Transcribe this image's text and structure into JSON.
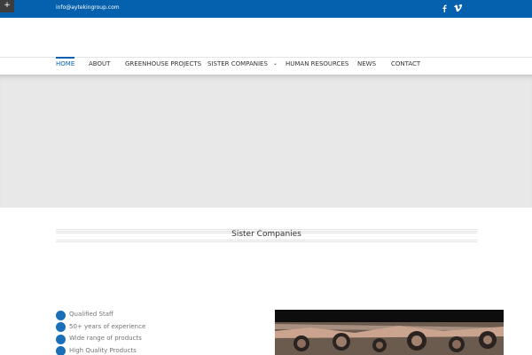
{
  "topbar": {
    "email": "info@aytekingroup.com",
    "corner_symbol": "+",
    "social": [
      {
        "icon": "facebook-icon"
      },
      {
        "icon": "vimeo-icon"
      }
    ],
    "background_color": "#0561ad"
  },
  "nav": {
    "items": [
      {
        "label": "HOME",
        "active": true
      },
      {
        "label": "ABOUT"
      },
      {
        "label": "GREENHOUSE PROJECTS"
      },
      {
        "label": "SISTER COMPANIES",
        "has_dropdown": true
      },
      {
        "label": "HUMAN RESOURCES"
      },
      {
        "label": "NEWS"
      },
      {
        "label": "CONTACT"
      }
    ],
    "accent_color": "#0561ad"
  },
  "section": {
    "title": "Sister Companies"
  },
  "features": [
    "Qualified Staff",
    "50+ years of experience",
    "Wide range of products",
    "High Quality Products"
  ],
  "bullet_color": "#1a70b8"
}
